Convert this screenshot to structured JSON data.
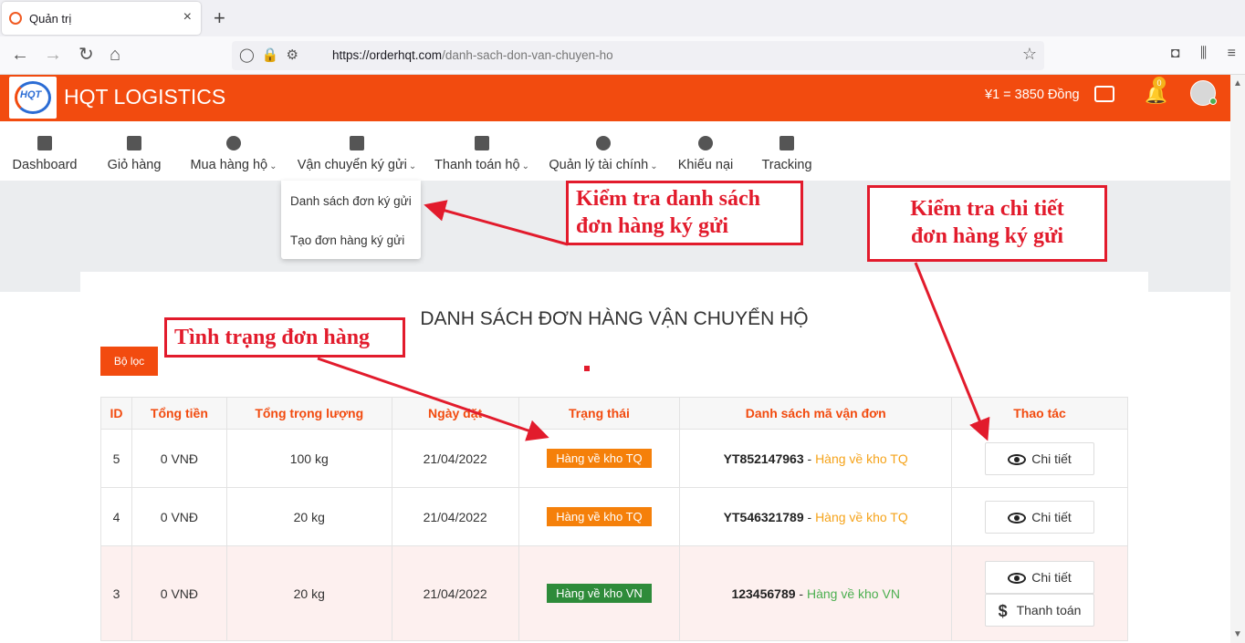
{
  "browser": {
    "tab_title": "Quản trị",
    "tab_close": "×",
    "new_tab": "+",
    "url_host": "https://orderhqt.com",
    "url_path": "/danh-sach-don-van-chuyen-ho",
    "nav_icons": [
      "back-icon",
      "forward-icon",
      "reload-icon",
      "home-icon"
    ]
  },
  "header": {
    "logo_text": "HQT",
    "brand": "HQT LOGISTICS",
    "rate": "¥1 = 3850 Đồng",
    "notification_count": "0",
    "accent_color": "#f24b0f"
  },
  "menu": [
    {
      "label": "Dashboard",
      "icon": "dashboard-icon"
    },
    {
      "label": "Giỏ hàng",
      "icon": "cart-icon"
    },
    {
      "label": "Mua hàng hộ",
      "icon": "purchase-icon",
      "caret": true
    },
    {
      "label": "Vận chuyển ký gửi",
      "icon": "consignment-icon",
      "caret": true
    },
    {
      "label": "Thanh toán hộ",
      "icon": "payment-icon",
      "caret": true
    },
    {
      "label": "Quản lý tài chính",
      "icon": "finance-icon",
      "caret": true
    },
    {
      "label": "Khiếu nại",
      "icon": "complaint-icon"
    },
    {
      "label": "Tracking",
      "icon": "truck-icon"
    }
  ],
  "dropdown": {
    "items": [
      "Danh sách đơn ký gửi",
      "Tạo đơn hàng ký gửi"
    ]
  },
  "page": {
    "title": "DANH SÁCH ĐƠN HÀNG VẬN CHUYỂN HỘ",
    "filter_button": "Bộ lọc"
  },
  "table": {
    "headers": [
      "ID",
      "Tổng tiền",
      "Tổng trọng lượng",
      "Ngày đặt",
      "Trạng thái",
      "Danh sách mã vận đơn",
      "Thao tác"
    ],
    "rows": [
      {
        "id": "5",
        "total": "0 VNĐ",
        "weight": "100 kg",
        "date": "21/04/2022",
        "status": "Hàng về kho TQ",
        "code": "YT852147963",
        "sep": " - ",
        "code_status": "Hàng về kho TQ",
        "actions": [
          "Chi tiết"
        ]
      },
      {
        "id": "4",
        "total": "0 VNĐ",
        "weight": "20 kg",
        "date": "21/04/2022",
        "status": "Hàng về kho TQ",
        "code": "YT546321789",
        "sep": " - ",
        "code_status": "Hàng về kho TQ",
        "actions": [
          "Chi tiết"
        ]
      },
      {
        "id": "3",
        "total": "0 VNĐ",
        "weight": "20 kg",
        "date": "21/04/2022",
        "status": "Hàng về kho VN",
        "code": "123456789",
        "sep": " - ",
        "code_status": "Hàng về kho VN",
        "actions": [
          "Chi tiết",
          "Thanh toán"
        ]
      }
    ]
  },
  "annotations": {
    "check_list_line1": "Kiểm tra danh sách",
    "check_list_line2": "đơn hàng ký gửi",
    "check_detail_line1": "Kiểm tra chi tiết",
    "check_detail_line2": "đơn hàng ký gửi",
    "status": "Tình trạng đơn hàng",
    "color": "#e21b2c"
  }
}
